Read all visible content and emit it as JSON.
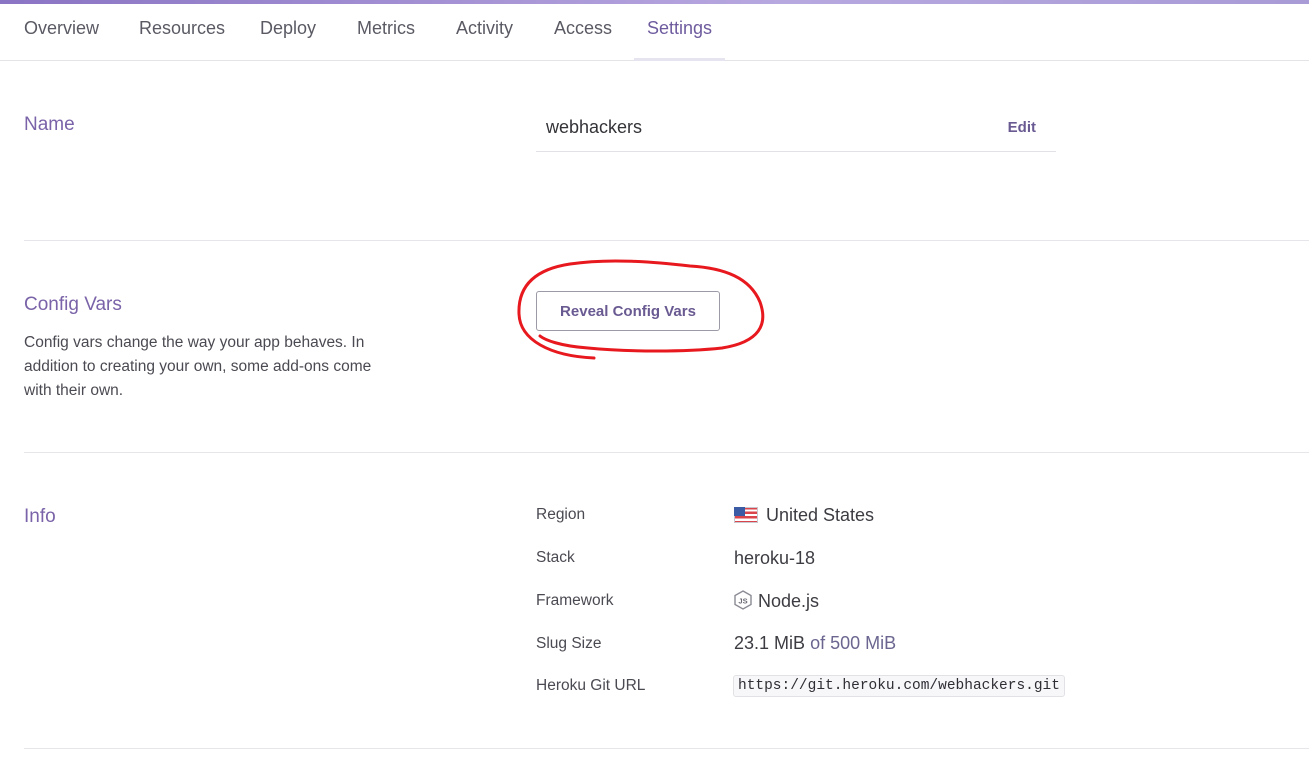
{
  "nav": {
    "tabs": [
      {
        "label": "Overview"
      },
      {
        "label": "Resources"
      },
      {
        "label": "Deploy"
      },
      {
        "label": "Metrics"
      },
      {
        "label": "Activity"
      },
      {
        "label": "Access"
      },
      {
        "label": "Settings",
        "active": true
      }
    ]
  },
  "name_section": {
    "title": "Name",
    "value": "webhackers",
    "edit_label": "Edit"
  },
  "config_section": {
    "title": "Config Vars",
    "description": "Config vars change the way your app behaves. In addition to creating your own, some add-ons come with their own.",
    "reveal_label": "Reveal Config Vars"
  },
  "info_section": {
    "title": "Info",
    "region_label": "Region",
    "region_value": "United States",
    "region_icon": "us-flag-icon",
    "stack_label": "Stack",
    "stack_value": "heroku-18",
    "framework_label": "Framework",
    "framework_value": "Node.js",
    "framework_icon": "nodejs-icon",
    "slug_label": "Slug Size",
    "slug_value": "23.1 MiB",
    "slug_limit": "of 500 MiB",
    "git_label": "Heroku Git URL",
    "git_url": "https://git.heroku.com/webhackers.git"
  },
  "colors": {
    "accent": "#7a63a8",
    "annotation": "#e8191e"
  }
}
